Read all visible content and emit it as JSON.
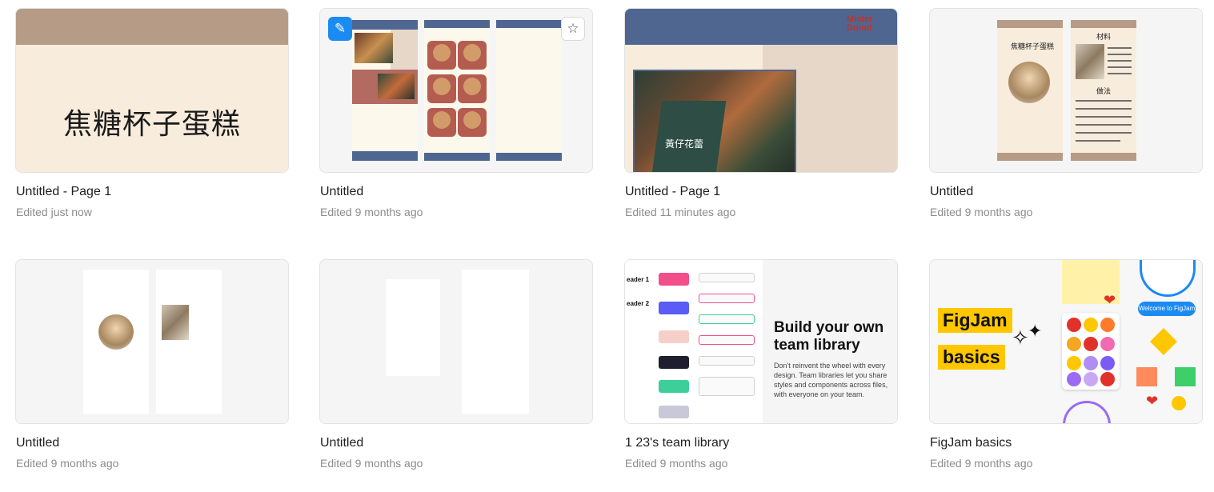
{
  "files": [
    {
      "name": "Untitled - Page 1",
      "meta": "Edited just now",
      "thumb_title": "焦糖杯子蛋糕"
    },
    {
      "name": "Untitled",
      "meta": "Edited 9 months ago",
      "badge_icon": "pen-tool-icon",
      "favorite_icon": "star-icon"
    },
    {
      "name": "Untitled - Page 1",
      "meta": "Edited 11 minutes ago",
      "logo": "Mister Donut",
      "cup_text": "黃仔花蕾"
    },
    {
      "name": "Untitled",
      "meta": "Edited 9 months ago",
      "left_title": "焦糖杯子蛋糕",
      "right_title": "材料",
      "method_title": "做法"
    },
    {
      "name": "Untitled",
      "meta": "Edited 9 months ago"
    },
    {
      "name": "Untitled",
      "meta": "Edited 9 months ago"
    },
    {
      "name": "1 23's team library",
      "meta": "Edited 9 months ago",
      "headline": "Build your own team library",
      "description": "Don't reinvent the wheel with every design. Team libraries let you share styles and components across files, with everyone on your team.",
      "side_labels": [
        "eader 1",
        "eader 2"
      ]
    },
    {
      "name": "FigJam basics",
      "meta": "Edited 9 months ago",
      "label_1": "FigJam",
      "label_2": "basics",
      "chat": "Welcome to FigJam"
    }
  ],
  "colors": {
    "brown": "#b69c86",
    "cream": "#f8ecdc",
    "navy": "#4f6790",
    "figma_blue": "#1b8bf2",
    "figjam_yellow": "#ffc700"
  }
}
